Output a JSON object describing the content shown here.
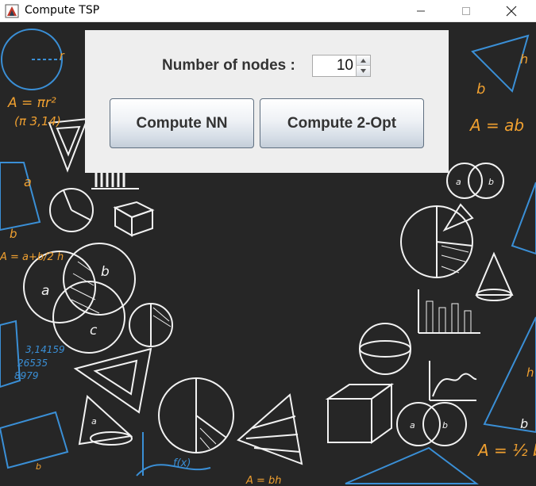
{
  "window": {
    "title": "Compute TSP",
    "icons": {
      "app": "java-app-icon",
      "minimize": "minimize-icon",
      "maximize": "maximize-icon",
      "close": "close-icon"
    }
  },
  "panel": {
    "nodes_label": "Number of nodes :",
    "nodes_value": "10",
    "compute_nn_label": "Compute NN",
    "compute_2opt_label": "Compute 2-Opt"
  },
  "background": {
    "chalk_texts": [
      "r",
      "A = πr²",
      "(π 3,14)",
      "a",
      "b",
      "A = a+b/2 h",
      "a",
      "b",
      "c",
      "3,14159",
      "26535",
      "8979",
      "f(x)",
      "A = bh",
      "b",
      "h",
      "A = ab",
      "a",
      "b",
      "h",
      "b",
      "A = ½ bh",
      "a",
      "b",
      "a",
      "b"
    ],
    "colors": {
      "board": "#262626",
      "chalk": "#f2f2f2",
      "blue": "#3a8fd6",
      "orange": "#f0a030"
    }
  }
}
